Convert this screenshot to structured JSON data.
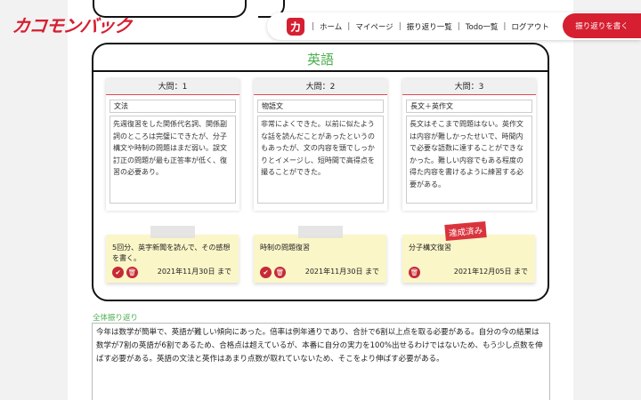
{
  "brand": {
    "logo_text": "カコモンバック",
    "nav_logo_glyph": "カ"
  },
  "nav": {
    "items": [
      "ホーム",
      "マイページ",
      "振り返り一覧",
      "Todo一覧",
      "ログアウト"
    ],
    "separator": "|",
    "write_button": "振り返りを書く"
  },
  "subject": {
    "title": "英語",
    "questions": [
      {
        "header": "大問：1",
        "topic": "文法",
        "text": "先週復習をした関係代名詞、関係副詞のところは完璧にできたが、分子構文や時制の問題はまだ弱い。誤文訂正の問題が最も正答率が低く、復習の必要あり。"
      },
      {
        "header": "大問：2",
        "topic": "物語文",
        "text": "非常によくできた。以前に似たような話を読んだことがあったというのもあったが、文の内容を頭でしっかりとイメージし、短時間で高得点を撮ることができた。"
      },
      {
        "header": "大問：3",
        "topic": "長文＋英作文",
        "text": "長文はそこまで問題はない。英作文は内容が難しかったせいで、時間内で必要な語数に達することができなかった。難しい内容でもある程度の得た内容を書けるように練習する必要がある。"
      }
    ],
    "todos": [
      {
        "text": "5回分、英字新聞を読んで、その感想を書く。",
        "date": "2021年11月30日 まで",
        "done": false
      },
      {
        "text": "時制の問題復習",
        "date": "2021年11月30日 まで",
        "done": false
      },
      {
        "text": "分子構文復習",
        "date": "2021年12月05日 まで",
        "done": true,
        "stamp": "達成済み"
      }
    ]
  },
  "overall": {
    "label": "全体振り返り",
    "text": "今年は数学が簡単で、英語が難しい傾向にあった。倍率は例年通りであり、合計で6割以上点を取る必要がある。自分の今の結果は数学が7割の英語が6割であるため、合格点は超えているが、本番に自分の実力を100%出せるわけではないため、もう少し点数を伸ばす必要がある。英語の文法と英作はあまり点数が取れていないため、そこをより伸ばす必要がある。"
  },
  "icons": {
    "check": "check-icon",
    "trash": "trash-icon"
  },
  "colors": {
    "brand_red": "#d61f31",
    "accent_green": "#4caf50",
    "note_yellow": "#fbf6c8"
  }
}
